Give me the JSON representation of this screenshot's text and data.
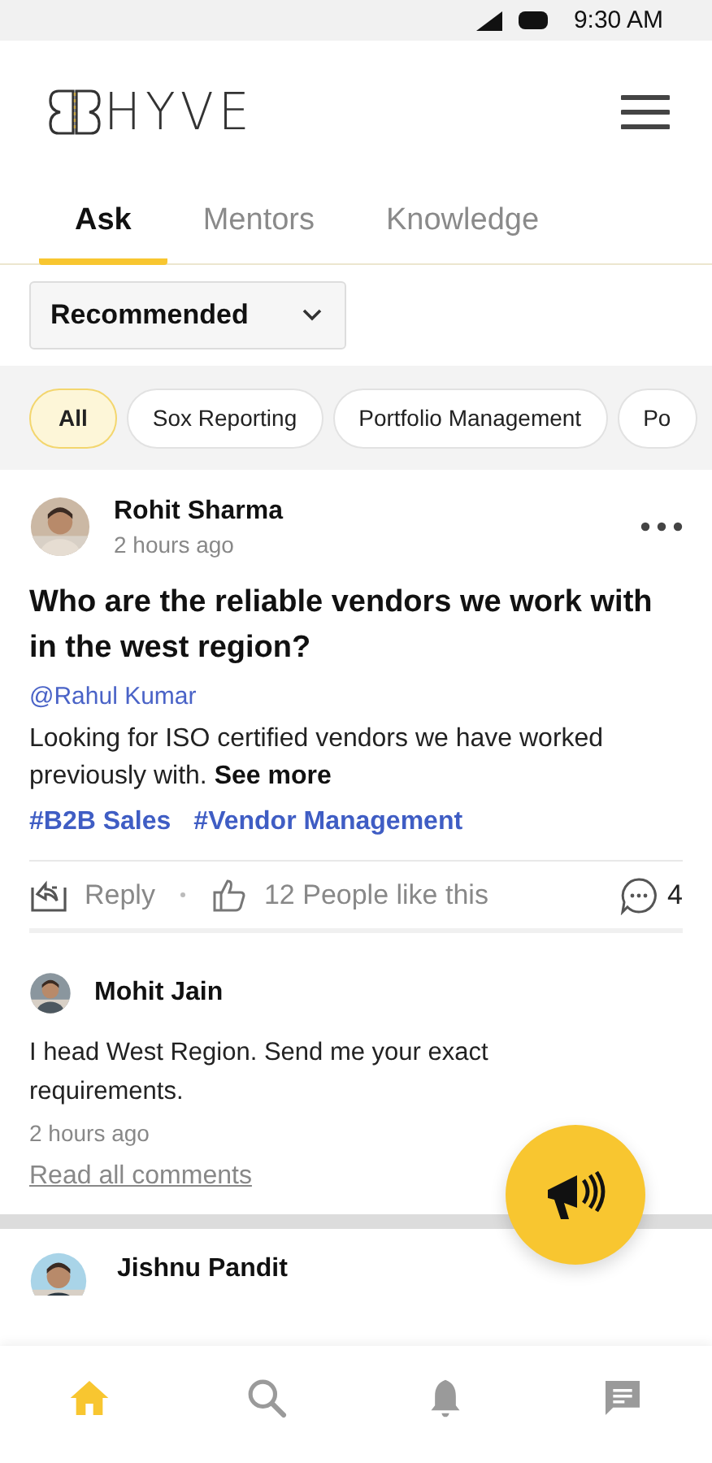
{
  "status_bar": {
    "time": "9:30 AM"
  },
  "header": {
    "logo_text": "HYVE"
  },
  "tabs": [
    {
      "label": "Ask",
      "selected": true
    },
    {
      "label": "Mentors",
      "selected": false
    },
    {
      "label": "Knowledge",
      "selected": false
    }
  ],
  "sort_dropdown": {
    "value": "Recommended"
  },
  "filter_chips": [
    {
      "label": "All",
      "selected": true
    },
    {
      "label": "Sox Reporting",
      "selected": false
    },
    {
      "label": "Portfolio Management",
      "selected": false
    },
    {
      "label": "Po",
      "selected": false
    }
  ],
  "post": {
    "author": "Rohit Sharma",
    "time": "2 hours ago",
    "question": "Who are the reliable vendors we work with in the west region?",
    "mention": "@Rahul Kumar",
    "body": "Looking for ISO certified vendors we have worked previously with. **See more**",
    "hashtags": [
      "#B2B Sales",
      "#Vendor Management"
    ],
    "reply_label": "Reply",
    "likes": "12 People like this",
    "comment_count": "4",
    "comment": {
      "author": "Mohit Jain",
      "text": "I head West Region. Send me your exact requirements.",
      "time": "2 hours ago"
    },
    "read_all": "Read all comments"
  },
  "next_post": {
    "author": "Jishnu Pandit"
  },
  "bottom_nav": [
    {
      "selected": true
    },
    {
      "selected": false
    },
    {
      "selected": false
    },
    {
      "selected": false
    }
  ]
}
